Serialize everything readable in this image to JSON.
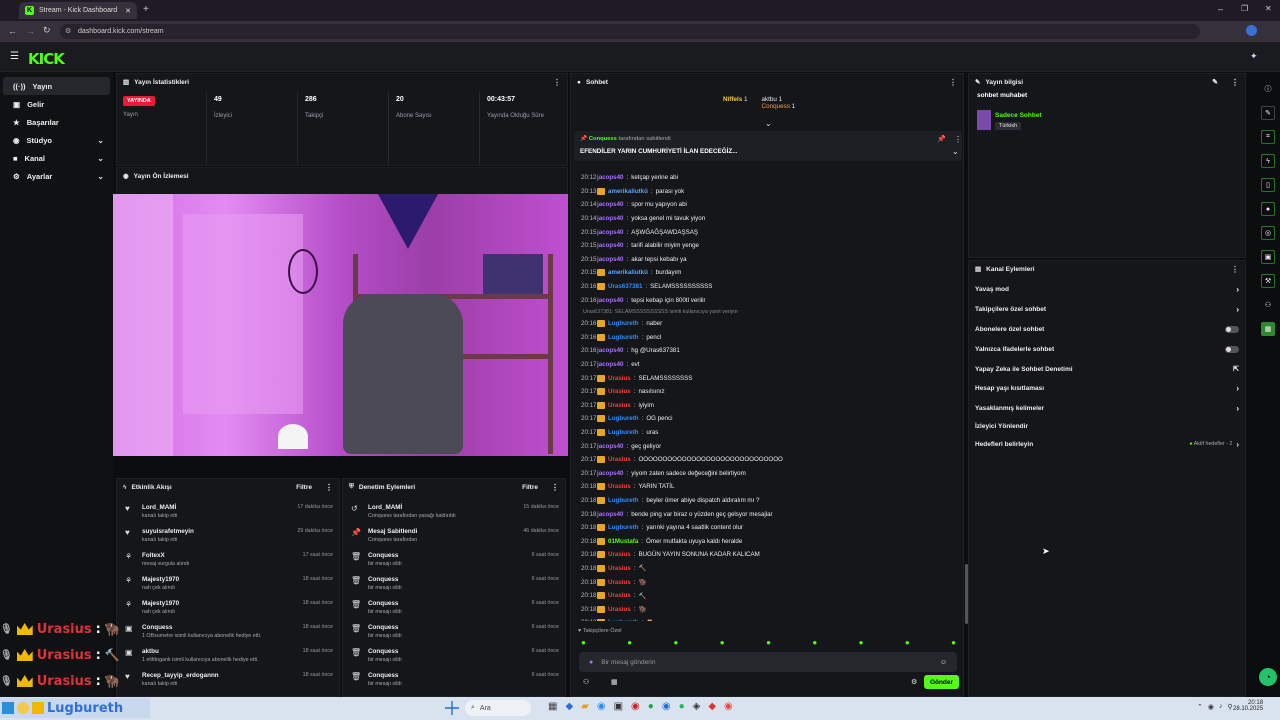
{
  "browser": {
    "tab_title": "Stream - Kick Dashboard",
    "url": "dashboard.kick.com/stream"
  },
  "brand": {
    "logo": "KICK",
    "accent": "#53fc18"
  },
  "sidebar": {
    "items": [
      {
        "label": "Yayın",
        "active": true
      },
      {
        "label": "Gelir"
      },
      {
        "label": "Başarılar"
      },
      {
        "label": "Stüdyo",
        "expandable": true
      },
      {
        "label": "Kanal",
        "expandable": true
      },
      {
        "label": "Ayarlar",
        "expandable": true
      }
    ]
  },
  "stats": {
    "title": "Yayın İstatistikleri",
    "live_badge": "YAYINDA",
    "live_label": "Yayın",
    "viewers": "49",
    "viewers_label": "İzleyici",
    "followers": "286",
    "followers_label": "Takipçi",
    "subs": "20",
    "subs_label": "Abone Sayısı",
    "duration": "00:43:57",
    "duration_label": "Yayında Olduğu Süre"
  },
  "preview": {
    "title": "Yayın Ön İzlemesi"
  },
  "activity": {
    "title": "Etkinlik Akışı",
    "filter": "Filtre",
    "rows": [
      {
        "name": "Lord_MAMİ",
        "sub": "kanalı takip etti",
        "time": "17 dakika önce"
      },
      {
        "name": "suyuisrafetmeyin",
        "sub": "kanalı takip etti",
        "time": "29 dakika önce"
      },
      {
        "name": "FoltexX",
        "sub": "mesaj vurgula alındı",
        "time": "17 saat önce"
      },
      {
        "name": "Majesty1970",
        "sub": "nah çek alındı",
        "time": "18 saat önce"
      },
      {
        "name": "Majesty1970",
        "sub": "nah çek alındı",
        "time": "18 saat önce"
      },
      {
        "name": "Conquess",
        "sub": "1 OBsumetre isimli kullanıcıya abonelik hediye etti.",
        "time": "18 saat önce"
      },
      {
        "name": "aktbu",
        "sub": "1 elifdogank isimli kullanıcıya abonelik hediye etti.",
        "time": "18 saat önce"
      },
      {
        "name": "Recep_tayyip_erdogannn",
        "sub": "kanalı takip etti",
        "time": "18 saat önce"
      }
    ]
  },
  "moderation": {
    "title": "Denetim Eylemleri",
    "filter": "Filtre",
    "rows": [
      {
        "name": "Lord_MAMİ",
        "sub": "Conquess tarafından yasağı kaldırıldı",
        "time": "15 dakika önce"
      },
      {
        "name": "Mesaj Sabitlendi",
        "sub": "Conquess tarafından",
        "time": "46 dakika önce"
      },
      {
        "name": "Conquess",
        "sub": "bir mesajı sildi",
        "time": "6 saat önce"
      },
      {
        "name": "Conquess",
        "sub": "bir mesajı sildi",
        "time": "6 saat önce"
      },
      {
        "name": "Conquess",
        "sub": "bir mesajı sildi",
        "time": "6 saat önce"
      },
      {
        "name": "Conquess",
        "sub": "bir mesajı sildi",
        "time": "6 saat önce"
      },
      {
        "name": "Conquess",
        "sub": "bir mesajı sildi",
        "time": "6 saat önce"
      },
      {
        "name": "Conquess",
        "sub": "bir mesajı sildi",
        "time": "6 saat önce"
      }
    ]
  },
  "chat": {
    "title": "Sohbet",
    "top_gifters": [
      {
        "name": "Niffels",
        "count": "1"
      },
      {
        "name": "aktbu",
        "count": "1"
      },
      {
        "name": "Conquess",
        "count": "1"
      }
    ],
    "pinned_by": "Conquess",
    "pinned_by_suffix": "tarafından sabitlendi",
    "pinned_text": "EFENDİLER YARIN CUMHURİYETİ İLAN EDECEĞİZ...",
    "messages": [
      {
        "t": "20:12",
        "u": "jacops40",
        "c": "#a970ff",
        "m": "ketçap yerine abi"
      },
      {
        "t": "20:13",
        "u": "amerikaliutkü",
        "c": "#5aa3ff",
        "m": "parası yok"
      },
      {
        "t": "20:14",
        "u": "jacops40",
        "c": "#a970ff",
        "m": "spor mu yapıyon abi"
      },
      {
        "t": "20:14",
        "u": "jacops40",
        "c": "#a970ff",
        "m": "yoksa genel mi tavuk yiyon"
      },
      {
        "t": "20:15",
        "u": "jacops40",
        "c": "#a970ff",
        "m": "AŞWĞAĞŞAWDAŞSAŞ"
      },
      {
        "t": "20:15",
        "u": "jacops40",
        "c": "#a970ff",
        "m": "tarifi alabilir miyim yenge"
      },
      {
        "t": "20:15",
        "u": "jacops40",
        "c": "#a970ff",
        "m": "akar tepsi kebabı ya"
      },
      {
        "t": "20:15",
        "u": "amerikaliutkü",
        "c": "#5aa3ff",
        "m": "burdayım"
      },
      {
        "t": "20:16",
        "u": "Uras637381",
        "c": "#2f8cff",
        "m": "SELAMSSSSSSSSSS"
      },
      {
        "t": "20:16",
        "u": "jacops40",
        "c": "#a970ff",
        "m": "tepsi kebap için 800tl verilir"
      },
      {
        "t": "20:16",
        "u": "Lugbureth",
        "c": "#2f8cff",
        "m": "naber"
      },
      {
        "t": "20:16",
        "u": "Lugbureth",
        "c": "#2f8cff",
        "m": "pencl"
      },
      {
        "t": "20:16",
        "u": "jacops40",
        "c": "#a970ff",
        "m": "hg @Uras637381"
      },
      {
        "t": "20:17",
        "u": "jacops40",
        "c": "#a970ff",
        "m": "evt"
      },
      {
        "t": "20:17",
        "u": "Urasius",
        "c": "#ff3b3b",
        "m": "SELAMSSSSSSSS"
      },
      {
        "t": "20:17",
        "u": "Urasius",
        "c": "#ff3b3b",
        "m": "nasılsınız"
      },
      {
        "t": "20:17",
        "u": "Urasius",
        "c": "#ff3b3b",
        "m": "iyiyim"
      },
      {
        "t": "20:17",
        "u": "Lugbureth",
        "c": "#2f8cff",
        "m": "OG penci"
      },
      {
        "t": "20:17",
        "u": "Lugbureth",
        "c": "#2f8cff",
        "m": "uras"
      },
      {
        "t": "20:17",
        "u": "jacops40",
        "c": "#a970ff",
        "m": "geç geliyor"
      },
      {
        "t": "20:17",
        "u": "Urasius",
        "c": "#ff3b3b",
        "m": "OOOOOOOOOOOOOOOOOOOOOOOOOOOOOO"
      },
      {
        "t": "20:17",
        "u": "jacops40",
        "c": "#a970ff",
        "m": "yiyom zaten sadece değeceğini belirtiyom"
      },
      {
        "t": "20:18",
        "u": "Urasius",
        "c": "#ff3b3b",
        "m": "YARIN TATİL"
      },
      {
        "t": "20:18",
        "u": "Lugbureth",
        "c": "#2f8cff",
        "m": "beyler ömer abiye dispatch aldıralım mı ?"
      },
      {
        "t": "20:18",
        "u": "jacops40",
        "c": "#a970ff",
        "m": "bende ping var biraz o yüzden geç gelsyor mesajlar"
      },
      {
        "t": "20:18",
        "u": "Lugbureth",
        "c": "#2f8cff",
        "m": "yarınki yayına 4 saatlik content olur"
      },
      {
        "t": "20:18",
        "u": "01Mustafa",
        "c": "#53fc18",
        "m": "Ömer mutfakta uyuya kaldı heralde"
      },
      {
        "t": "20:18",
        "u": "Urasius",
        "c": "#ff3b3b",
        "m": "BUGÜN YAYIN SONUNA KADAR KALICAM"
      },
      {
        "t": "20:18",
        "u": "Urasius",
        "c": "#ff3b3b",
        "m": "🔨"
      },
      {
        "t": "20:18",
        "u": "Urasius",
        "c": "#ff3b3b",
        "m": "🦬"
      },
      {
        "t": "20:18",
        "u": "Urasius",
        "c": "#ff3b3b",
        "m": "🔨"
      },
      {
        "t": "20:18",
        "u": "Urasius",
        "c": "#ff3b3b",
        "m": "🦬"
      },
      {
        "t": "20:18",
        "u": "Lugbureth",
        "c": "#2f8cff",
        "m": "🪵"
      }
    ],
    "reply_note": "Uras637381: SELAMSSSSSSSSSS isimli kullanıcıya yanıt veriyor",
    "followers_mode": "Takipçilere Özel",
    "input_placeholder": "Bir mesaj gönderin",
    "send": "Gönder"
  },
  "stream_info": {
    "title": "Yayın bilgisi",
    "stream_title": "sohbet muhabet",
    "category": "Sadece Sohbet",
    "language": "Türkish"
  },
  "channel_actions": {
    "title": "Kanal Eylemleri",
    "items": [
      {
        "label": "Yavaş mod",
        "kind": "arrow"
      },
      {
        "label": "Takipçilere özel sohbet",
        "kind": "arrow"
      },
      {
        "label": "Abonelere özel sohbet",
        "kind": "toggle"
      },
      {
        "label": "Yalnızca ifadelerle sohbet",
        "kind": "toggle"
      },
      {
        "label": "Yapay Zeka ile Sohbet Denetimi",
        "kind": "external"
      },
      {
        "label": "Hesap yaşı kısıtlaması",
        "kind": "arrow"
      },
      {
        "label": "Yasaklanmış kelimeler",
        "kind": "arrow"
      },
      {
        "label": "İzleyici Yönlendir",
        "kind": "none"
      },
      {
        "label": "Hedefleri belirleyin",
        "kind": "arrow"
      }
    ],
    "goals_status": "Aktif hedefler - 2"
  },
  "overlay": {
    "rows": [
      {
        "name": "Urasius"
      },
      {
        "name": "Urasius"
      },
      {
        "name": "Urasius"
      }
    ],
    "bottom_name": "Lugbureth"
  },
  "taskbar": {
    "search": "Ara",
    "time": "20:18",
    "date": "28.10.2025"
  }
}
